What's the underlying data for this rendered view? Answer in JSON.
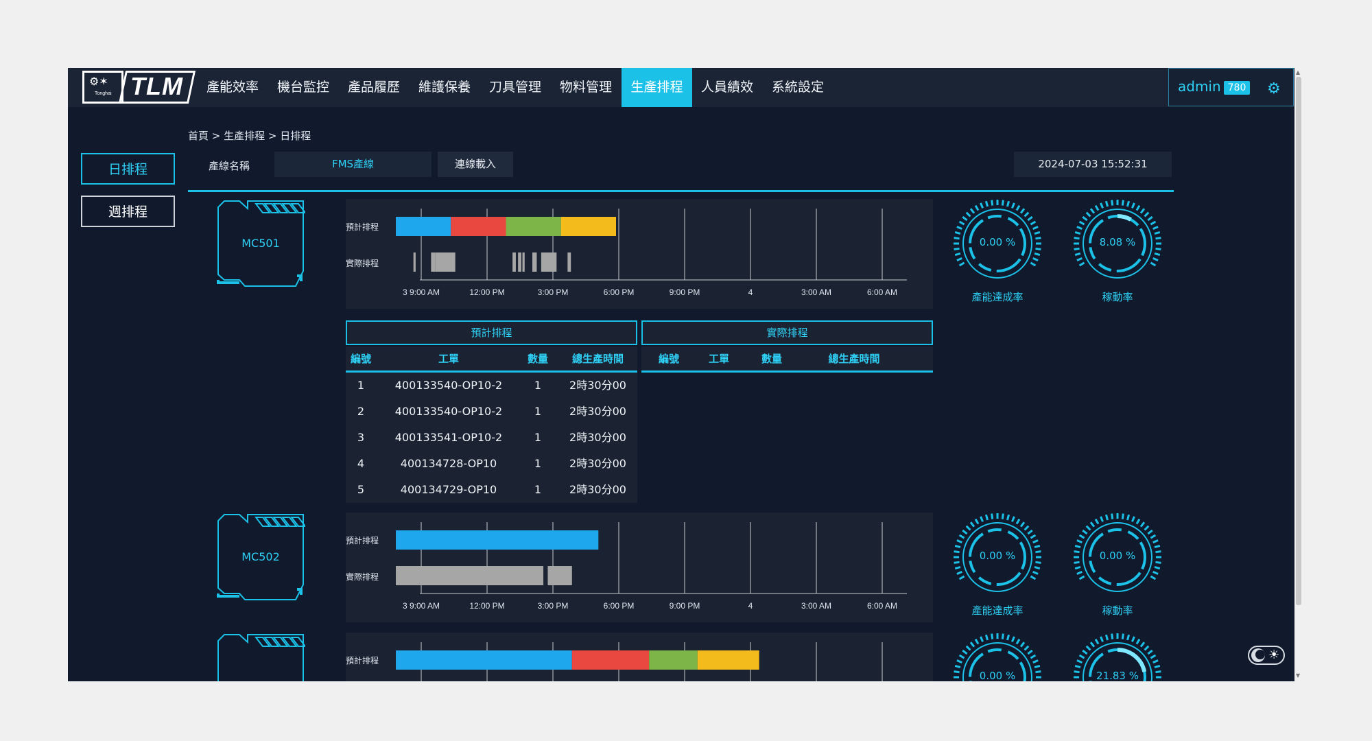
{
  "nav": {
    "logo_text": "TLM",
    "logo_small": "Tonghai",
    "items": [
      "產能效率",
      "機台監控",
      "產品履歷",
      "維護保養",
      "刀具管理",
      "物料管理",
      "生產排程",
      "人員績效",
      "系統設定"
    ],
    "active_item": "生產排程"
  },
  "user": {
    "name": "admin",
    "badge": "780"
  },
  "sidebar": {
    "tabs": [
      "日排程",
      "週排程"
    ]
  },
  "breadcrumb": "首頁 > 生產排程 > 日排程",
  "filter": {
    "line_label": "產線名稱",
    "line_value": "FMS產線",
    "load_button": "連線載入"
  },
  "datetime": "2024-07-03 15:52:31",
  "timeline": {
    "ticks": [
      "3 9:00 AM",
      "12:00 PM",
      "3:00 PM",
      "6:00 PM",
      "9:00 PM",
      "4",
      "3:00 AM",
      "6:00 AM"
    ],
    "plan_label": "預計排程",
    "actual_label": "實際排程"
  },
  "colors": {
    "accent": "#1cc1e8",
    "blue": "#1fa7ee",
    "red": "#e8483f",
    "green": "#7db548",
    "yellow": "#f3bb1c",
    "gray": "#a6a6a6"
  },
  "gauge_labels": {
    "capacity": "產能達成率",
    "utilization": "稼動率"
  },
  "machines": [
    {
      "name": "MC501",
      "capacity": "0.00 %",
      "capacity_value": 0,
      "utilization": "8.08 %",
      "utilization_value": 8.08,
      "plan_segments": [
        {
          "start": 0.0,
          "end": 2.5,
          "color": "blue"
        },
        {
          "start": 2.5,
          "end": 5.0,
          "color": "red"
        },
        {
          "start": 5.0,
          "end": 7.5,
          "color": "green"
        },
        {
          "start": 7.5,
          "end": 10.0,
          "color": "yellow"
        }
      ],
      "actual_segments": [
        {
          "start": 0.8,
          "end": 0.9
        },
        {
          "start": 1.6,
          "end": 1.8
        },
        {
          "start": 1.8,
          "end": 2.7
        },
        {
          "start": 5.3,
          "end": 5.45
        },
        {
          "start": 5.55,
          "end": 5.7
        },
        {
          "start": 5.75,
          "end": 5.85
        },
        {
          "start": 6.2,
          "end": 6.4
        },
        {
          "start": 6.6,
          "end": 7.3
        },
        {
          "start": 7.8,
          "end": 7.95
        }
      ]
    },
    {
      "name": "MC502",
      "capacity": "0.00 %",
      "capacity_value": 0,
      "utilization": "0.00 %",
      "utilization_value": 0,
      "plan_segments": [
        {
          "start": 0.0,
          "end": 9.2,
          "color": "blue"
        }
      ],
      "actual_segments": [
        {
          "start": 0.0,
          "end": 6.7
        },
        {
          "start": 6.9,
          "end": 8.0
        }
      ]
    },
    {
      "name": "",
      "capacity": "0.00 %",
      "capacity_value": 0,
      "utilization": "21.83 %",
      "utilization_value": 21.83,
      "plan_segments": [
        {
          "start": 0.0,
          "end": 8.0,
          "color": "blue"
        },
        {
          "start": 8.0,
          "end": 11.5,
          "color": "red"
        },
        {
          "start": 11.5,
          "end": 13.7,
          "color": "green"
        },
        {
          "start": 13.7,
          "end": 16.5,
          "color": "yellow"
        }
      ],
      "actual_segments": []
    }
  ],
  "schedule_table": {
    "plan_title": "預計排程",
    "actual_title": "實際排程",
    "plan_columns": [
      "編號",
      "工單",
      "數量",
      "總生產時間"
    ],
    "actual_columns": [
      "編號",
      "工單",
      "數量",
      "總生產時間"
    ],
    "plan_rows": [
      [
        "1",
        "400133540-OP10-2",
        "1",
        "2時30分00"
      ],
      [
        "2",
        "400133540-OP10-2",
        "1",
        "2時30分00"
      ],
      [
        "3",
        "400133541-OP10-2",
        "1",
        "2時30分00"
      ],
      [
        "4",
        "400134728-OP10",
        "1",
        "2時30分00"
      ],
      [
        "5",
        "400134729-OP10",
        "1",
        "2時30分00"
      ]
    ],
    "actual_rows": []
  }
}
